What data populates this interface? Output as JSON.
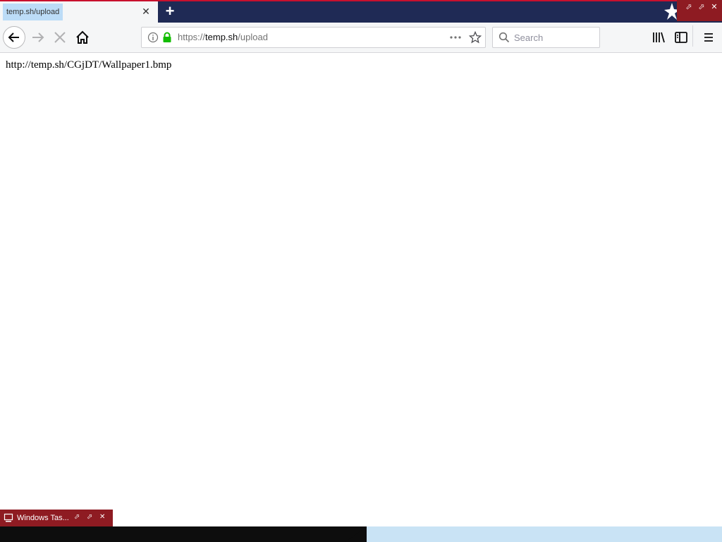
{
  "browser": {
    "tab": {
      "title": "temp.sh/upload"
    },
    "new_tab_icon": "plus-icon",
    "url": {
      "protocol": "https://",
      "host": "temp.sh",
      "path": "/upload"
    },
    "search": {
      "placeholder": "Search"
    }
  },
  "page": {
    "text": "http://temp.sh/CGjDT/Wallpaper1.bmp"
  },
  "taskbar": {
    "item_label": "Windows Tas..."
  },
  "colors": {
    "titlebar": "#1f2a55",
    "accent_red": "#8e1b22",
    "secure_lock": "#12bc00",
    "tab_highlight": "#bcdcf7"
  }
}
